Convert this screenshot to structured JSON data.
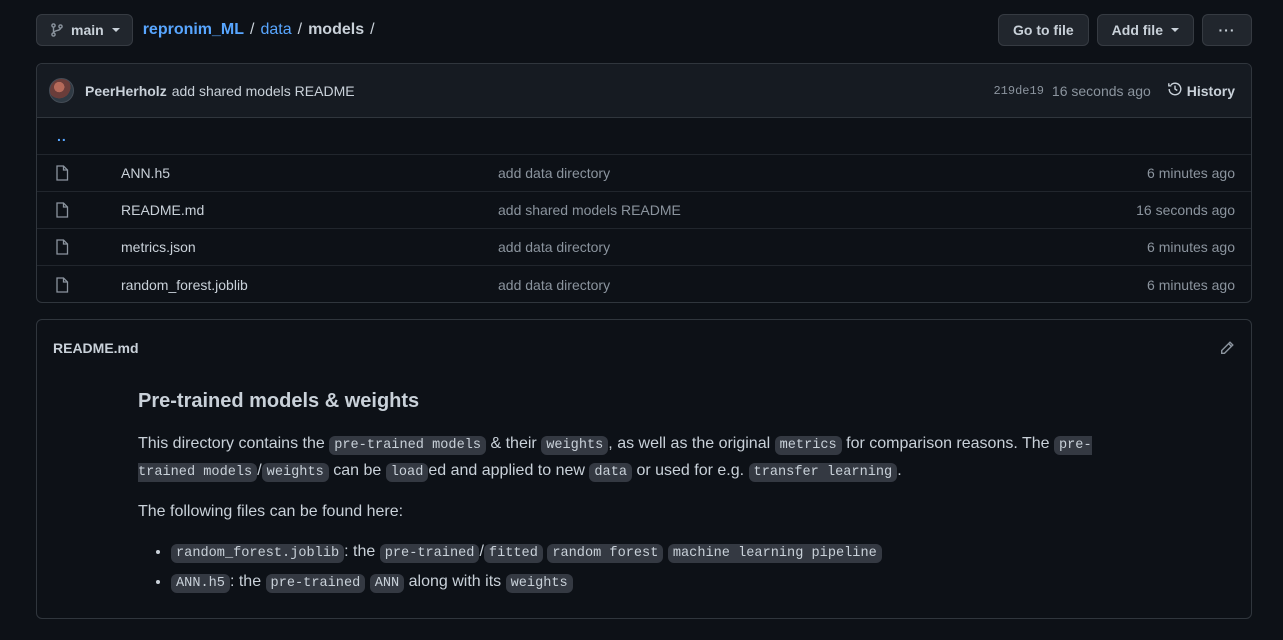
{
  "branch": {
    "label": "main"
  },
  "breadcrumb": {
    "root": "repronim_ML",
    "sep1": "/",
    "folder": "data",
    "sep2": "/",
    "current": "models",
    "sep3": "/"
  },
  "actions": {
    "go_to_file": "Go to file",
    "add_file": "Add file",
    "more": "···"
  },
  "commit": {
    "author": "PeerHerholz",
    "message": "add shared models README",
    "sha": "219de19",
    "time": "16 seconds ago",
    "history_label": "History"
  },
  "parent_link": "..",
  "files": [
    {
      "name": "ANN.h5",
      "message": "add data directory",
      "time": "6 minutes ago"
    },
    {
      "name": "README.md",
      "message": "add shared models README",
      "time": "16 seconds ago"
    },
    {
      "name": "metrics.json",
      "message": "add data directory",
      "time": "6 minutes ago"
    },
    {
      "name": "random_forest.joblib",
      "message": "add data directory",
      "time": "6 minutes ago"
    }
  ],
  "readme": {
    "filename": "README.md",
    "heading": "Pre-trained models & weights",
    "p1": {
      "t1": "This directory contains the ",
      "c1": "pre-trained models",
      "t2": " & their ",
      "c2": "weights",
      "t3": ", as well as the original ",
      "c3": "metrics",
      "t4": " for comparison reasons. The ",
      "c4": "pre-trained models",
      "t5": "/",
      "c5": "weights",
      "t6": " can be ",
      "c6": "load",
      "t7": "ed and applied to new ",
      "c7": "data",
      "t8": " or used for e.g. ",
      "c8": "transfer learning",
      "t9": "."
    },
    "p2": "The following files can be found here:",
    "li1": {
      "c1": "random_forest.joblib",
      "t1": ": the ",
      "c2": "pre-trained",
      "t2": "/",
      "c3": "fitted",
      "c4": "random forest",
      "c5": "machine learning pipeline"
    },
    "li2": {
      "c1": "ANN.h5",
      "t1": ": the ",
      "c2": "pre-trained",
      "c3": "ANN",
      "t2": " along with its ",
      "c4": "weights"
    }
  }
}
